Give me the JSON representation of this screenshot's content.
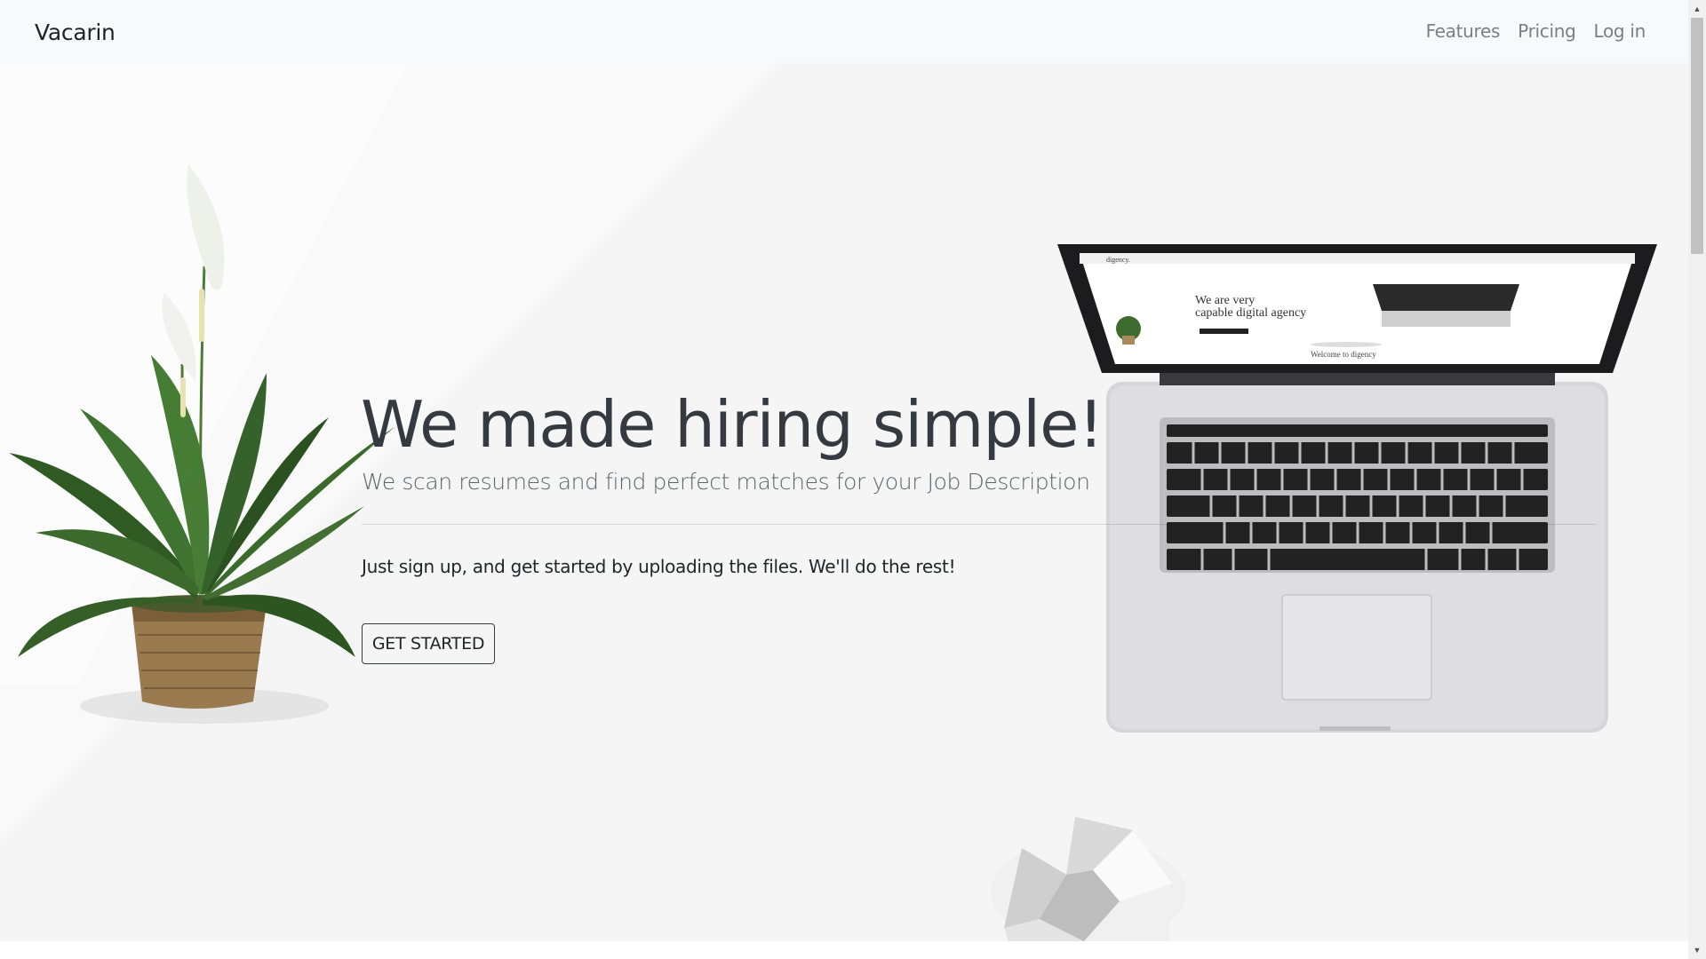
{
  "navbar": {
    "brand": "Vacarin",
    "links": [
      {
        "label": "Features"
      },
      {
        "label": "Pricing"
      },
      {
        "label": "Log in"
      }
    ]
  },
  "hero": {
    "headline": "We made hiring simple!",
    "subheadline": "We scan resumes and find perfect matches for your Job Description",
    "lead": "Just sign up, and get started by uploading the files. We'll do the rest!",
    "cta_label": "GET STARTED"
  },
  "colors": {
    "background": "#f5f5f5",
    "navbar": "#f8f9fa",
    "text": "#343a40",
    "muted": "#7a7f85"
  },
  "icons": [
    "scroll-up-arrow-icon",
    "scroll-down-arrow-icon"
  ]
}
